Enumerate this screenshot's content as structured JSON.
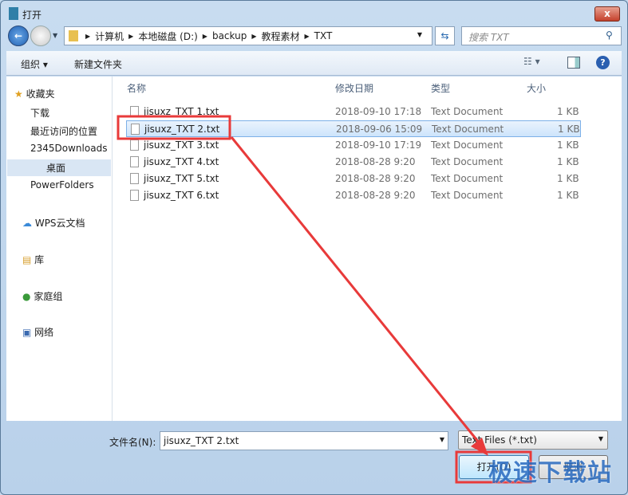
{
  "window": {
    "title": "打开",
    "close": "x"
  },
  "address": {
    "segments": [
      "计算机",
      "本地磁盘 (D:)",
      "backup",
      "教程素材",
      "TXT"
    ],
    "search_placeholder": "搜索 TXT"
  },
  "toolbar": {
    "organize": "组织 ▾",
    "new_folder": "新建文件夹"
  },
  "sidebar": {
    "items": [
      {
        "label": "收藏夹"
      },
      {
        "label": "下载"
      },
      {
        "label": "最近访问的位置"
      },
      {
        "label": "2345Downloads"
      },
      {
        "label": "桌面"
      },
      {
        "label": "PowerFolders"
      },
      {
        "label": "WPS云文档"
      },
      {
        "label": "库"
      },
      {
        "label": "家庭组"
      },
      {
        "label": "网络"
      }
    ]
  },
  "columns": [
    "名称",
    "修改日期",
    "类型",
    "大小"
  ],
  "files": [
    {
      "name": "jisuxz_TXT 1.txt",
      "date": "2018-09-10 17:18",
      "type": "Text Document",
      "size": "1 KB"
    },
    {
      "name": "jisuxz_TXT 2.txt",
      "date": "2018-09-06 15:09",
      "type": "Text Document",
      "size": "1 KB"
    },
    {
      "name": "jisuxz_TXT 3.txt",
      "date": "2018-09-10 17:19",
      "type": "Text Document",
      "size": "1 KB"
    },
    {
      "name": "jisuxz_TXT 4.txt",
      "date": "2018-08-28 9:20",
      "type": "Text Document",
      "size": "1 KB"
    },
    {
      "name": "jisuxz_TXT 5.txt",
      "date": "2018-08-28 9:20",
      "type": "Text Document",
      "size": "1 KB"
    },
    {
      "name": "jisuxz_TXT 6.txt",
      "date": "2018-08-28 9:20",
      "type": "Text Document",
      "size": "1 KB"
    }
  ],
  "footer": {
    "filename_label": "文件名(N):",
    "filename_value": "jisuxz_TXT 2.txt",
    "filter": "Text Files (*.txt)",
    "open": "打开(O)",
    "cancel": "取消"
  },
  "watermark": "极速下载站",
  "colors": {
    "annotation": "#e83a3a",
    "selection": "#cde4fb"
  }
}
